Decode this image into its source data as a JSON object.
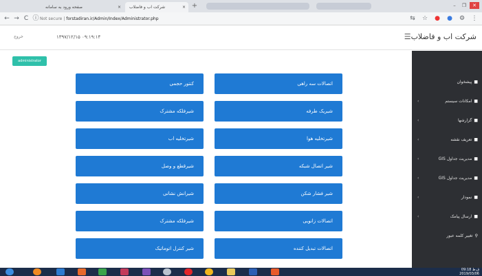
{
  "browser": {
    "tabs": [
      {
        "label": "",
        "close": ""
      },
      {
        "label": "صفحه ورود به سامانه",
        "close": "×"
      },
      {
        "label": "شرکت اب و فاضلاب",
        "close": "×"
      }
    ],
    "new_tab": "+",
    "address": {
      "security": "Not secure",
      "separator": "|",
      "url": "forstadiran.ir/Admin/Index/Administrator.php"
    },
    "window_buttons": [
      "–",
      "❐",
      "✕"
    ],
    "nav": {
      "back": "←",
      "forward": "→",
      "reload": "C",
      "info": "ⓘ"
    },
    "toolbar_icons": [
      "⇆",
      "☆",
      "●",
      "●",
      "⚙",
      "⋮"
    ]
  },
  "header": {
    "brand": "شرکت اب و فاضلاب",
    "hamburger": "☰",
    "user_link": "خروج",
    "datetime": "۱۳۹۷/۱۲/۱۵  ۰۹:۱۹:۱۴"
  },
  "content": {
    "green_button": "administrator",
    "tiles_left": [
      "کنتور حجمی",
      "شیرفلکه مشترک",
      "شیرتخلیه اب",
      "شیرقطع و وصل",
      "شیرانش نشانی",
      "شیرفلکه مشترک",
      "شیر کنترل اتوماتیک"
    ],
    "tiles_right": [
      "اتصالات سه راهی",
      "شیریک طرفه",
      "شیرتخلیه هوا",
      "شیر اتصال شبکه",
      "شیر فشار شکن",
      "اتصالات زانویی",
      "اتصالات تبدیل کننده"
    ]
  },
  "sidebar": {
    "items": [
      {
        "icon": "■",
        "label": "پیشخوان",
        "chevron": ""
      },
      {
        "icon": "■",
        "label": "امکانات سیستم",
        "chevron": "‹"
      },
      {
        "icon": "■",
        "label": "گزارشها",
        "chevron": "‹"
      },
      {
        "icon": "■",
        "label": "تعریف نقشه",
        "chevron": "‹"
      },
      {
        "icon": "■",
        "label": "مدیریت جداول GIS",
        "chevron": "‹"
      },
      {
        "icon": "■",
        "label": "مدیریت جداول GIS",
        "chevron": "‹"
      },
      {
        "icon": "■",
        "label": "نمودار",
        "chevron": "‹"
      },
      {
        "icon": "■",
        "label": "ارسال پیامک",
        "chevron": "‹"
      },
      {
        "icon": "⚲",
        "label": "تغییر کلمه عبور",
        "chevron": ""
      }
    ]
  },
  "taskbar": {
    "time": "09:18 ق.ظ",
    "date": "2019/03/06"
  },
  "colors": {
    "tile": "#1f7ad4",
    "sidebar": "#2d2f33",
    "accent_green": "#2fc0aa",
    "taskbar": "#1c2d4a"
  }
}
